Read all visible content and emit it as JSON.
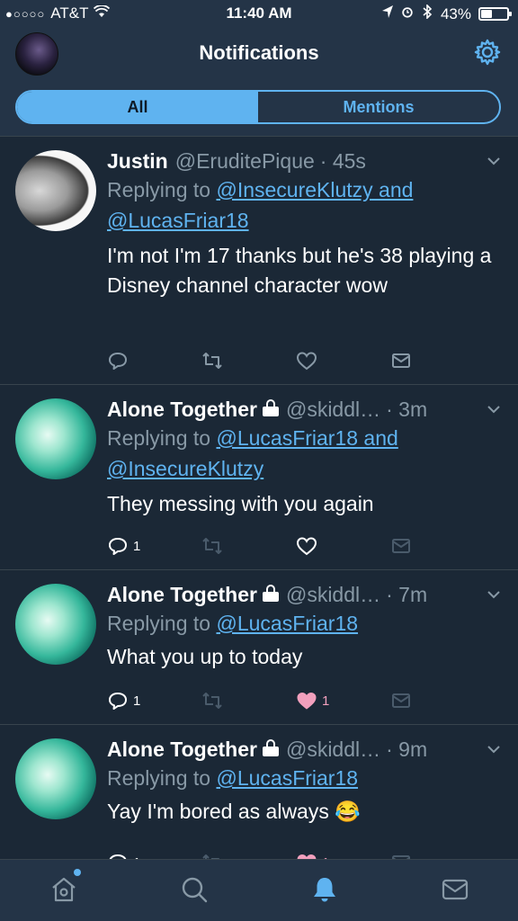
{
  "status_bar": {
    "carrier": "AT&T",
    "time": "11:40 AM",
    "battery_percent": "43%",
    "battery_level": 0.43
  },
  "header": {
    "title": "Notifications"
  },
  "segments": {
    "all": "All",
    "mentions": "Mentions",
    "selected": "All"
  },
  "tweets": [
    {
      "name": "Justin",
      "handle": "@EruditePique",
      "time": "· 45s",
      "replying_prefix": "Replying to",
      "replying_links": "@InsecureKlutzy and @LucasFriar18",
      "text": "I'm not I'm 17 thanks but he's 38 playing a Disney channel character wow",
      "reply_count": "",
      "like_count": "",
      "liked": false
    },
    {
      "name": "Alone Together",
      "handle": "@skiddl…",
      "time": "· 3m",
      "replying_prefix": "Replying to",
      "replying_links": "@LucasFriar18 and @InsecureKlutzy",
      "text": "They messing with you again",
      "reply_count": "1",
      "like_count": "",
      "liked": false
    },
    {
      "name": "Alone Together",
      "handle": "@skiddl…",
      "time": "· 7m",
      "replying_prefix": "Replying to",
      "replying_links": "@LucasFriar18",
      "text": "What you up to today",
      "reply_count": "1",
      "like_count": "1",
      "liked": true
    },
    {
      "name": "Alone Together",
      "handle": "@skiddl…",
      "time": "· 9m",
      "replying_prefix": "Replying to",
      "replying_links": "@LucasFriar18",
      "text": "Yay I'm bored as always 😂",
      "reply_count": "1",
      "like_count": "1",
      "liked": true
    }
  ],
  "tab_bar": {
    "items": [
      "home-icon",
      "search-icon",
      "notifications-icon",
      "messages-icon"
    ],
    "active": "notifications-icon"
  },
  "colors": {
    "background": "#1b2836",
    "bar": "#243447",
    "accent": "#5fb3f0",
    "muted": "#8899a6",
    "like": "#e0245e"
  }
}
